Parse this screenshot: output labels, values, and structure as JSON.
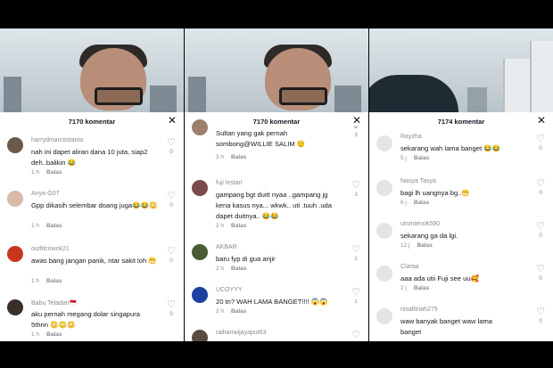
{
  "panels": [
    {
      "title": "7170 komentar",
      "comments": [
        {
          "user": "harrydmarcostanto",
          "text": "nah ini dapet aliran dana 10 juta, siap2 deh..balikin 😂",
          "time": "1 h",
          "reply": "Balas",
          "likes": "0"
        },
        {
          "user": "Anya-G07",
          "text": "Gpp dikasih selembar doang juga😂😂😳",
          "time": "1 h",
          "reply": "Balas",
          "likes": "0"
        },
        {
          "user": "outfitcowok21",
          "text": "awas bang jangan panik, ntar sakit loh 😁",
          "time": "1 h",
          "reply": "Balas",
          "likes": "0"
        },
        {
          "user": "Babu Teladan🇲🇨",
          "text": "aku pernah megang dolar singapura 5thnn 😳😳😳",
          "time": "1 h",
          "reply": "Balas",
          "likes": "0"
        }
      ]
    },
    {
      "title": "7170 komentar",
      "comments": [
        {
          "user": "",
          "text": "Sultan yang gak pernah sombong@WILLIE SALIM 😌",
          "time": "3 h",
          "reply": "Balas",
          "likes": "3"
        },
        {
          "user": "fuji lestari",
          "text": "gampang bgt duitt nyaa ..gampang jg kena kasus nya... wkwk.. uti .tuuh .uda dapet duitnya.. 😂😂",
          "time": "2 h",
          "reply": "Balas",
          "likes": "3"
        },
        {
          "user": "AKBAR",
          "text": "baru fyp di gua anjir",
          "time": "2 h",
          "reply": "Balas",
          "likes": "1"
        },
        {
          "user": "UCOYYY",
          "text": "20 tn? WAH LAMA BANGET!!!! 😱😱",
          "time": "2 h",
          "reply": "Balas",
          "likes": "1"
        },
        {
          "user": "raihanwijayaput63",
          "text": "",
          "time": "",
          "reply": "",
          "likes": ""
        }
      ]
    },
    {
      "title": "7174 komentar",
      "comments": [
        {
          "user": "Rayzha",
          "text": "sekarang wah lama banget 😂😂",
          "time": "5 j",
          "reply": "Balas",
          "likes": "0"
        },
        {
          "user": "Nasya Tasya",
          "text": "bagi lh uangnya bg..😁",
          "time": "6 j",
          "reply": "Balas",
          "likes": "0"
        },
        {
          "user": "ummienok590",
          "text": "sekarang ga da lgi.",
          "time": "12 j",
          "reply": "Balas",
          "likes": "0"
        },
        {
          "user": "Claraa",
          "text": "aaa ada utii Fuji see uu🥰",
          "time": "2 j",
          "reply": "Balas",
          "likes": "0"
        },
        {
          "user": "nisafitriah279",
          "text": "waw banyak banget waw lama banget",
          "time": "",
          "reply": "",
          "likes": "0"
        }
      ]
    }
  ],
  "icons": {
    "close": "close-icon",
    "heart": "heart-icon"
  },
  "colors": {
    "sheet": "#ffffff",
    "muted": "#8a8b91",
    "text": "#161823"
  }
}
